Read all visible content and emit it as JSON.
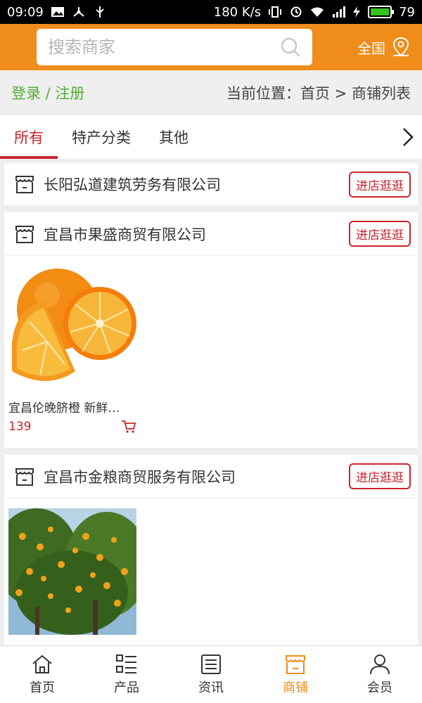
{
  "status_bar": {
    "time": "09:09",
    "speed": "180 K/s",
    "battery": "79",
    "colors": {
      "battery_fill": "#35c21f"
    }
  },
  "search": {
    "placeholder": "搜索商家",
    "region_label": "全国"
  },
  "breadcrumb": {
    "login_label": "登录 / 注册",
    "current_location": "当前位置：首页 > 商铺列表"
  },
  "tabs": [
    {
      "label": "所有",
      "active": true
    },
    {
      "label": "特产分类",
      "active": false
    },
    {
      "label": "其他",
      "active": false
    }
  ],
  "stores": [
    {
      "name": "长阳弘道建筑劳务有限公司",
      "visit_label": "进店逛逛",
      "products": []
    },
    {
      "name": "宜昌市果盛商贸有限公司",
      "visit_label": "进店逛逛",
      "products": [
        {
          "name": "宜昌伦晚脐橙 新鲜…",
          "price": "139",
          "image": "orange-image"
        }
      ]
    },
    {
      "name": "宜昌市金粮商贸服务有限公司",
      "visit_label": "进店逛逛",
      "products": [
        {
          "name": "",
          "price": "",
          "image": "orange-tree-image"
        }
      ]
    }
  ],
  "bottom_nav": [
    {
      "label": "首页",
      "icon": "home-icon",
      "active": false
    },
    {
      "label": "产品",
      "icon": "list-icon",
      "active": false
    },
    {
      "label": "资讯",
      "icon": "news-icon",
      "active": false
    },
    {
      "label": "商铺",
      "icon": "store-icon",
      "active": true
    },
    {
      "label": "会员",
      "icon": "user-icon",
      "active": false
    }
  ],
  "colors": {
    "header": "#f08c1a",
    "accent_red": "#c9242b",
    "login_green": "#4fae35"
  }
}
